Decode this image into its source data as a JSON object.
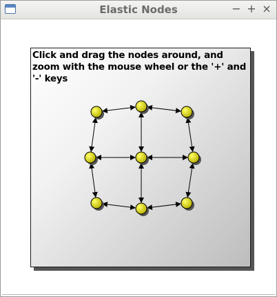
{
  "window": {
    "title": "Elastic Nodes",
    "icon": "window-icon",
    "controls": {
      "minimize": "−",
      "maximize": "+",
      "close": "×"
    }
  },
  "scene": {
    "instructions": "Click and drag the nodes around, and zoom with the mouse wheel or the '+' and '-' keys",
    "node_count": 9,
    "colors": {
      "node_fill": "#d6d000",
      "node_highlight": "#ffff66",
      "node_stroke": "#000000",
      "edge": "#000000",
      "background_light": "#ffffff",
      "background_dark": "#bdbdbd"
    }
  }
}
